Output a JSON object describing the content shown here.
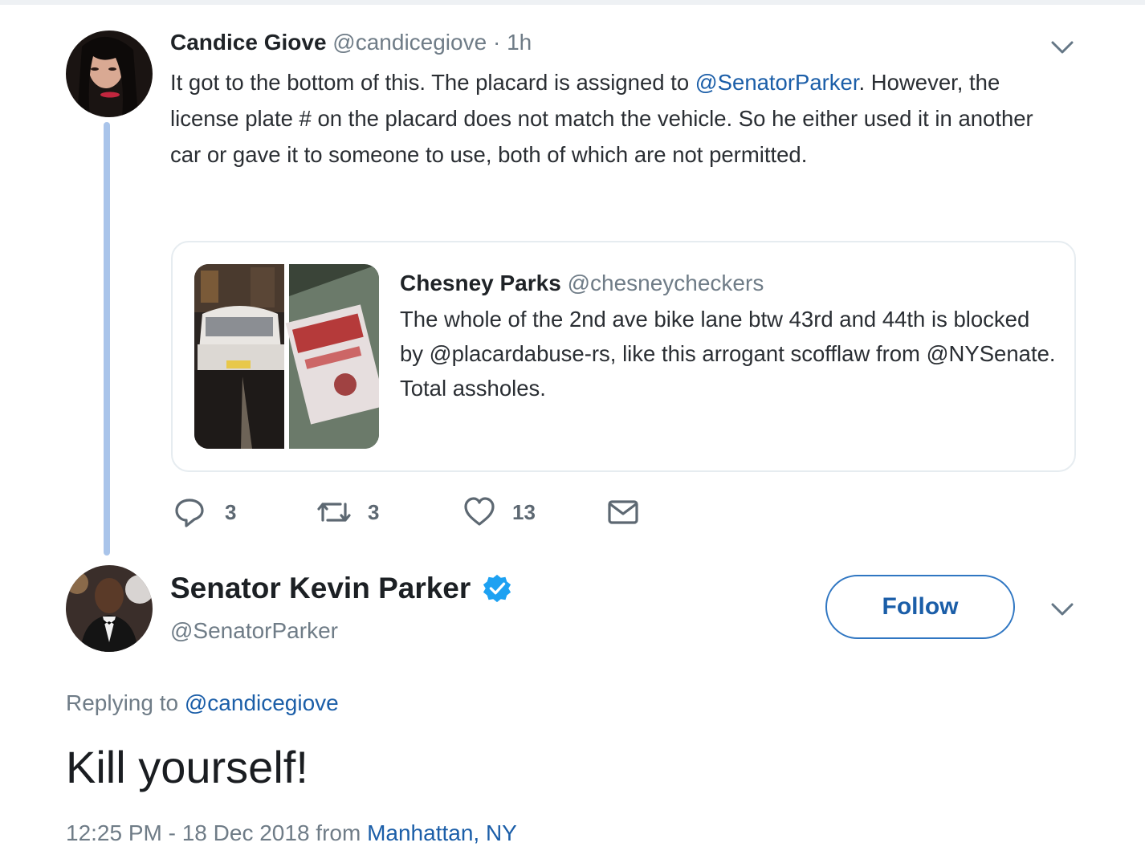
{
  "colors": {
    "link": "#1b5ea8",
    "thread_line": "#a9c4ea",
    "verified_badge": "#1da1f2",
    "muted_text": "#6f7c87"
  },
  "tweet1": {
    "author_name": "Candice Giove",
    "handle": "@candicegiove",
    "separator": "·",
    "time": "1h",
    "text_before_mention": "It got to the bottom of this. The placard  is assigned to ",
    "mention": "@SenatorParker",
    "text_after_mention": ". However, the license plate # on the placard does not match the vehicle. So he either used it in another car or gave it to someone to use, both of which are not permitted.",
    "more_icon": "chevron-down-icon",
    "quoted_tweet": {
      "author_name": "Chesney Parks",
      "handle": "@chesneycheckers",
      "text": "The whole of the 2nd ave bike lane btw 43rd and 44th is blocked by @placardabuse-rs, like this arrogant scofflaw from @NYSenate. Total assholes."
    },
    "actions": {
      "reply_count": "3",
      "retweet_count": "3",
      "like_count": "13"
    }
  },
  "tweet2": {
    "author_name": "Senator Kevin Parker",
    "verified_icon": "verified-badge-icon",
    "handle": "@SenatorParker",
    "follow_label": "Follow",
    "replying_prefix": "Replying to ",
    "replying_to": "@candicegiove",
    "text": "Kill yourself!",
    "timestamp": "12:25 PM - 18 Dec 2018 from ",
    "location": "Manhattan, NY"
  }
}
